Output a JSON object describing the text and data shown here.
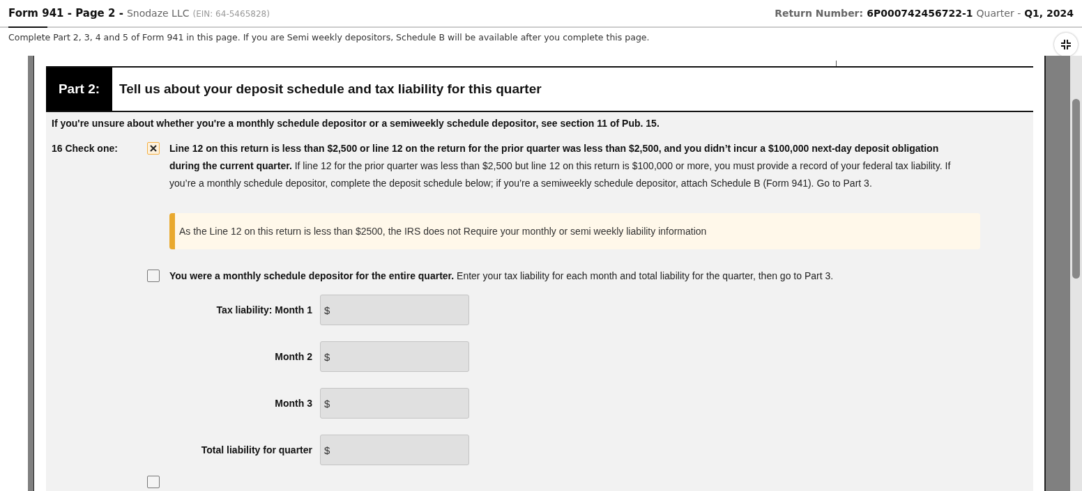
{
  "header": {
    "form_title": "Form 941 - Page 2 -",
    "company": "Snodaze LLC",
    "ein": "(EIN: 64-5465828)",
    "return_label": "Return Number:",
    "return_number": "6P000742456722-1",
    "quarter_label": "Quarter -",
    "quarter": "Q1, 2024"
  },
  "instructions": "Complete Part 2, 3, 4 and 5 of Form 941 in this page. If you are Semi weekly depositors, Schedule B will be available after you complete this page.",
  "part": {
    "number": "Part 2:",
    "title": "Tell us about your deposit schedule and tax liability for this quarter"
  },
  "note": "If you're unsure about whether you're a monthly schedule depositor or a semiweekly schedule depositor, see section 11 of Pub. 15.",
  "line_label": "16 Check one:",
  "options": [
    {
      "checked": true,
      "text": "**Line 12 on this return is less than $2,500 or line 12 on the return for the prior quarter was less than $2,500, and you didn’t incur a $100,000 next-day deposit obligation during the current quarter.** If line 12 for the prior quarter was less than $2,500 but line 12 on this return is $100,000 or more, you must provide a record of your federal tax liability. If you’re a monthly schedule depositor, complete the deposit schedule below; if you’re a semiweekly schedule depositor, attach Schedule B (Form 941). Go to Part 3.",
      "alert": "As the Line 12 on this return is less than $2500, the IRS does not Require your monthly or semi weekly liability information"
    },
    {
      "checked": false,
      "text": "**You were a monthly schedule depositor for the entire quarter.** Enter your tax liability for each month and total liability for the quarter, then go to Part 3.",
      "fields": [
        {
          "label": "Tax liability: Month 1",
          "prefix": "$"
        },
        {
          "label": "Month 2",
          "prefix": "$"
        },
        {
          "label": "Month 3",
          "prefix": "$"
        },
        {
          "label": "Total liability for quarter",
          "prefix": "$"
        }
      ]
    },
    {
      "checked": false
    }
  ]
}
